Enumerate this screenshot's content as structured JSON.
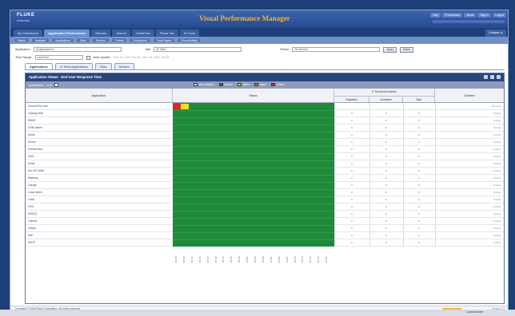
{
  "header": {
    "logo_line1": "FLUKE",
    "logo_line2": "networks",
    "product": "Visual Performance Manager",
    "links": [
      "Help",
      "Preferences",
      "About",
      "Sign In",
      "Logout"
    ]
  },
  "main_tabs": [
    {
      "label": "My Dashboard",
      "active": false
    },
    {
      "label": "Application Performance",
      "active": true
    },
    {
      "label": "Reports",
      "active": false
    },
    {
      "label": "Alarms",
      "active": false
    },
    {
      "label": "ClearFlow",
      "active": false
    },
    {
      "label": "Flows Tab",
      "active": false
    },
    {
      "label": "IS Tools",
      "active": false
    }
  ],
  "main_tabs_close": "Collapse ▲",
  "sub_tabs": [
    "Status",
    "Analysis",
    "Applications",
    "Sites",
    "Servers",
    "Trends",
    "Exceptions",
    "Trace Agent",
    "Show Activity"
  ],
  "filters": {
    "application_label": "Application",
    "application_value": "All Applications",
    "site_label": "Site",
    "site_value": "All Sites",
    "server_label": "Server",
    "server_value": "All Servers",
    "apply_button": "Apply",
    "reset_button": "Reset",
    "time_label": "Time Range",
    "time_value": "Last Hour",
    "auto_update_label": "Auto Update",
    "range_text": "Dec 19, 2007 15:23 - Dec 19, 2007 16:23"
  },
  "content_tabs": [
    {
      "label": "Applications",
      "active": true
    },
    {
      "label": "In Trend Applications",
      "active": false
    },
    {
      "label": "Sites",
      "active": false
    },
    {
      "label": "Servers",
      "active": false
    }
  ],
  "panel": {
    "title": "Application Status - End User Response Time",
    "toolbar_label": "Applications",
    "toolbar_sub": "1-19",
    "legend": [
      {
        "label": "Not Available",
        "color": "#ffffff"
      },
      {
        "label": "Normal",
        "color": "#1f8b3a"
      },
      {
        "label": "Minor",
        "color": "#f5e11a"
      },
      {
        "label": "Major",
        "color": "#ef7a1a"
      },
      {
        "label": "Critical",
        "color": "#e0242b"
      }
    ],
    "columns": {
      "application": "Application",
      "status": "Status",
      "alarms_group": "# Threshold Alarms",
      "degraded": "Degraded",
      "excessive": "Excessive",
      "total": "Total",
      "duration": "Duration"
    }
  },
  "rows": [
    {
      "app": "Overall End User",
      "degraded": "",
      "excessive": "",
      "total": "",
      "duration": "61 mins",
      "cells": [
        "#e0242b",
        "#e0242b",
        "#f5e11a",
        "#f5e11a"
      ]
    },
    {
      "app": "Catalog Web",
      "degraded": "0",
      "excessive": "0",
      "total": "0",
      "duration": "0 mins",
      "cells": []
    },
    {
      "app": "EBMS",
      "degraded": "0",
      "excessive": "0",
      "total": "0",
      "duration": "0 mins",
      "cells": []
    },
    {
      "app": "CRM-Siebel",
      "degraded": "0",
      "excessive": "0",
      "total": "0",
      "duration": "0 mins",
      "cells": []
    },
    {
      "app": "Danis",
      "degraded": "0",
      "excessive": "0",
      "total": "0",
      "duration": "0 mins",
      "cells": []
    },
    {
      "app": "Ethers",
      "degraded": "0",
      "excessive": "0",
      "total": "0",
      "duration": "0 mins",
      "cells": []
    },
    {
      "app": "Critical Alive",
      "degraded": "0",
      "excessive": "0",
      "total": "0",
      "duration": "0 mins",
      "cells": []
    },
    {
      "app": "Citrix",
      "degraded": "0",
      "excessive": "0",
      "total": "0",
      "duration": "0 mins",
      "cells": []
    },
    {
      "app": "Email",
      "degraded": "0",
      "excessive": "0",
      "total": "0",
      "duration": "0 mins",
      "cells": []
    },
    {
      "app": "Dev-HP-Wide",
      "degraded": "0",
      "excessive": "0",
      "total": "0",
      "duration": "0 mins",
      "cells": []
    },
    {
      "app": "Marimay",
      "degraded": "0",
      "excessive": "0",
      "total": "0",
      "duration": "0 mins",
      "cells": []
    },
    {
      "app": "Garage",
      "degraded": "0",
      "excessive": "0",
      "total": "0",
      "duration": "0 mins",
      "cells": []
    },
    {
      "app": "Lotus Notes",
      "degraded": "0",
      "excessive": "0",
      "total": "0",
      "duration": "0 mins",
      "cells": []
    },
    {
      "app": "Lotus",
      "degraded": "0",
      "excessive": "0",
      "total": "0",
      "duration": "0 mins",
      "cells": []
    },
    {
      "app": "CBS",
      "degraded": "0",
      "excessive": "0",
      "total": "0",
      "duration": "0 mins",
      "cells": []
    },
    {
      "app": "MSSQL",
      "degraded": "0",
      "excessive": "0",
      "total": "0",
      "duration": "0 mins",
      "cells": []
    },
    {
      "app": "Outlook",
      "degraded": "0",
      "excessive": "0",
      "total": "0",
      "duration": "0 mins",
      "cells": []
    },
    {
      "app": "Oracle",
      "degraded": "0",
      "excessive": "0",
      "total": "0",
      "duration": "0 mins",
      "cells": []
    },
    {
      "app": "SAP",
      "degraded": "0",
      "excessive": "0",
      "total": "0",
      "duration": "0 mins",
      "cells": []
    },
    {
      "app": "SMTP",
      "degraded": "0",
      "excessive": "0",
      "total": "0",
      "duration": "0 mins",
      "cells": []
    }
  ],
  "time_ticks": [
    "15:25",
    "15:28",
    "15:31",
    "15:34",
    "15:37",
    "15:40",
    "15:43",
    "15:46",
    "15:49",
    "15:52",
    "15:55",
    "15:58",
    "16:01",
    "16:04",
    "16:07",
    "16:10",
    "16:13",
    "16:16",
    "16:19",
    "16:22"
  ],
  "footer": {
    "copyright": "Copyright © 2008 Fluke Corporation. All rights reserved.",
    "version": "Version 3.1"
  },
  "taskbar": {
    "zone": "Local intranet"
  }
}
